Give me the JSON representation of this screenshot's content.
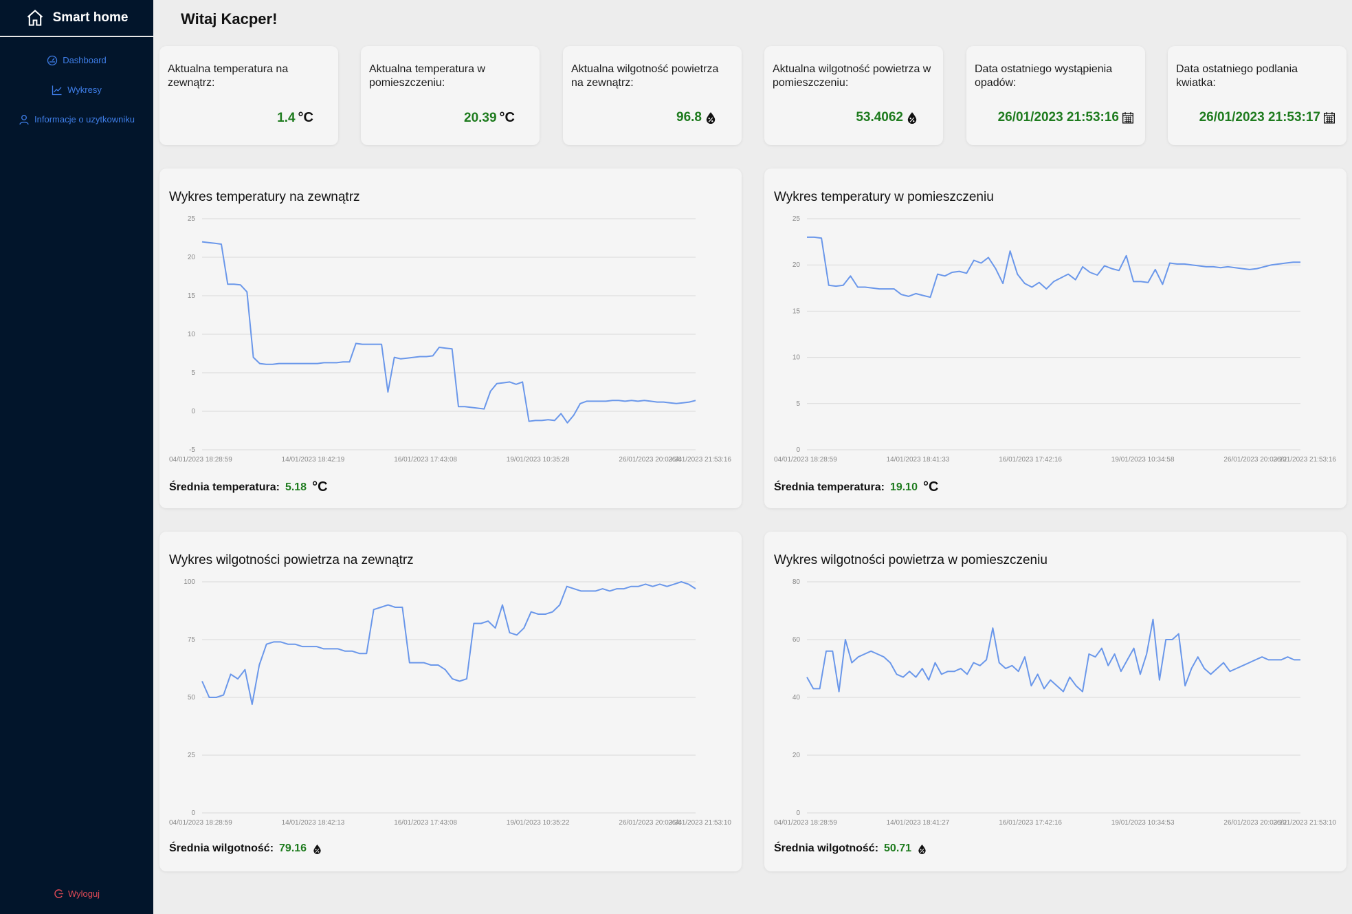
{
  "app": {
    "title": "Smart home"
  },
  "sidebar": {
    "items": [
      {
        "label": "Dashboard",
        "icon": "dashboard-icon"
      },
      {
        "label": "Wykresy",
        "icon": "chart-line-icon"
      },
      {
        "label": "Informacje o uzytkowniku",
        "icon": "user-icon"
      }
    ],
    "logout": "Wyloguj"
  },
  "greeting": "Witaj Kacper!",
  "stats": [
    {
      "label": "Aktualna temperatura na zewnątrz:",
      "value": "1.4",
      "unit": "°C",
      "icon": "none"
    },
    {
      "label": "Aktualna temperatura w pomieszczeniu:",
      "value": "20.39",
      "unit": "°C",
      "icon": "none"
    },
    {
      "label": "Aktualna wilgotność powietrza na zewnątrz:",
      "value": "96.8",
      "icon": "humidity-drop-icon"
    },
    {
      "label": "Aktualna wilgotność powietrza w pomieszczeniu:",
      "value": "53.4062",
      "icon": "humidity-drop-icon"
    },
    {
      "label": "Data ostatniego wystąpienia opadów:",
      "value": "26/01/2023 21:53:16",
      "icon": "calendar-icon"
    },
    {
      "label": "Data ostatniego podlania kwiatka:",
      "value": "26/01/2023 21:53:17",
      "icon": "calendar-icon"
    }
  ],
  "charts": {
    "temp_out": {
      "title": "Wykres temperatury na zewnątrz",
      "avg_label": "Średnia temperatura:",
      "avg_value": "5.18",
      "avg_unit": "°C"
    },
    "temp_in": {
      "title": "Wykres temperatury w pomieszczeniu",
      "avg_label": "Średnia temperatura:",
      "avg_value": "19.10",
      "avg_unit": "°C"
    },
    "hum_out": {
      "title": "Wykres wilgotności powietrza na zewnątrz",
      "avg_label": "Średnia wilgotność:",
      "avg_value": "79.16"
    },
    "hum_in": {
      "title": "Wykres wilgotności powietrza w pomieszczeniu",
      "avg_label": "Średnia wilgotność:",
      "avg_value": "50.71"
    }
  },
  "colors": {
    "sidebar": "#02152b",
    "accent": "#3f7ee8",
    "line": "#6a97ea",
    "value_green": "#1e7b1e",
    "logout": "#e04a56"
  },
  "chart_data": [
    {
      "type": "line",
      "title": "Wykres temperatury na zewnątrz",
      "ylim": [
        -5,
        25
      ],
      "yticks": [
        -5,
        0,
        5,
        10,
        15,
        20,
        25
      ],
      "x_ticks": [
        "04/01/2023 18:28:59",
        "14/01/2023 18:42:19",
        "16/01/2023 17:43:08",
        "19/01/2023 10:35:28",
        "26/01/2023 20:03:34",
        "26/01/2023 21:53:16"
      ],
      "series": [
        {
          "values": [
            22,
            21.9,
            21.8,
            21.7,
            16.5,
            16.5,
            16.4,
            15.5,
            7,
            6.2,
            6.1,
            6.1,
            6.2,
            6.2,
            6.2,
            6.2,
            6.2,
            6.2,
            6.2,
            6.3,
            6.3,
            6.3,
            6.4,
            6.4,
            8.8,
            8.7,
            8.7,
            8.7,
            8.7,
            2.5,
            7,
            6.8,
            6.9,
            7,
            7.1,
            7.1,
            7.2,
            8.3,
            8.2,
            8.1,
            0.6,
            0.6,
            0.5,
            0.4,
            0.3,
            2.6,
            3.6,
            3.7,
            3.8,
            3.5,
            3.8,
            -1.3,
            -1.2,
            -1.2,
            -1.1,
            -1.2,
            -0.3,
            -1.5,
            -0.5,
            1,
            1.3,
            1.3,
            1.3,
            1.3,
            1.4,
            1.4,
            1.3,
            1.4,
            1.3,
            1.4,
            1.3,
            1.2,
            1.2,
            1.1,
            1,
            1.1,
            1.2,
            1.4
          ]
        }
      ]
    },
    {
      "type": "line",
      "title": "Wykres temperatury w pomieszczeniu",
      "ylim": [
        0,
        25
      ],
      "yticks": [
        0,
        5,
        10,
        15,
        20,
        25
      ],
      "x_ticks": [
        "04/01/2023 18:28:59",
        "14/01/2023 18:41:33",
        "16/01/2023 17:42:16",
        "19/01/2023 10:34:58",
        "26/01/2023 20:03:12",
        "26/01/2023 21:53:16"
      ],
      "series": [
        {
          "values": [
            23,
            23,
            22.9,
            17.8,
            17.7,
            17.8,
            18.8,
            17.6,
            17.6,
            17.5,
            17.4,
            17.4,
            17.4,
            16.8,
            16.6,
            16.9,
            16.7,
            16.5,
            19,
            18.8,
            19.2,
            19.3,
            19.1,
            20.5,
            20.2,
            20.8,
            19.6,
            18,
            21.5,
            19,
            18,
            17.6,
            18.1,
            17.4,
            18.2,
            18.6,
            19,
            18.4,
            19.8,
            19.2,
            18.9,
            19.9,
            19.6,
            19.4,
            21,
            18.2,
            18.2,
            18.1,
            19.5,
            17.9,
            20.2,
            20.1,
            20.1,
            20,
            19.9,
            19.8,
            19.8,
            19.7,
            19.8,
            19.7,
            19.6,
            19.5,
            19.6,
            19.8,
            20,
            20.1,
            20.2,
            20.3,
            20.3
          ]
        }
      ]
    },
    {
      "type": "line",
      "title": "Wykres wilgotności powietrza na zewnątrz",
      "ylim": [
        0,
        100
      ],
      "yticks": [
        0,
        25,
        50,
        75,
        100
      ],
      "x_ticks": [
        "04/01/2023 18:28:59",
        "14/01/2023 18:42:13",
        "16/01/2023 17:43:08",
        "19/01/2023 10:35:22",
        "26/01/2023 20:03:34",
        "26/01/2023 21:53:10"
      ],
      "series": [
        {
          "values": [
            57,
            50,
            50,
            51,
            60,
            58,
            62,
            47,
            64,
            73,
            74,
            74,
            73,
            73,
            72,
            72,
            72,
            71,
            71,
            71,
            70,
            70,
            69,
            69,
            88,
            89,
            90,
            89,
            89,
            65,
            65,
            65,
            64,
            64,
            62,
            58,
            57,
            58,
            82,
            82,
            83,
            80,
            90,
            78,
            77,
            80,
            87,
            86,
            86,
            87,
            90,
            98,
            97,
            96,
            96,
            96,
            97,
            96,
            97,
            97,
            98,
            98,
            99,
            98,
            99,
            98,
            99,
            100,
            99,
            97
          ]
        }
      ]
    },
    {
      "type": "line",
      "title": "Wykres wilgotności powietrza w pomieszczeniu",
      "ylim": [
        0,
        80
      ],
      "yticks": [
        0,
        20,
        40,
        60,
        80
      ],
      "x_ticks": [
        "04/01/2023 18:28:59",
        "14/01/2023 18:41:27",
        "16/01/2023 17:42:16",
        "19/01/2023 10:34:53",
        "26/01/2023 20:03:12",
        "26/01/2023 21:53:10"
      ],
      "series": [
        {
          "values": [
            47,
            43,
            43,
            56,
            56,
            42,
            60,
            52,
            54,
            55,
            56,
            55,
            54,
            52,
            48,
            47,
            49,
            47,
            50,
            46,
            52,
            48,
            49,
            49,
            50,
            48,
            52,
            51,
            53,
            64,
            52,
            50,
            51,
            49,
            54,
            44,
            48,
            43,
            46,
            44,
            42,
            47,
            44,
            42,
            55,
            54,
            57,
            51,
            55,
            49,
            53,
            57,
            48,
            55,
            67,
            46,
            60,
            60,
            62,
            44,
            50,
            54,
            50,
            48,
            50,
            52,
            49,
            50,
            51,
            52,
            53,
            54,
            53,
            53,
            53,
            54,
            53,
            53
          ]
        }
      ]
    }
  ]
}
